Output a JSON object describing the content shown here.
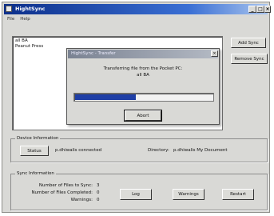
{
  "window": {
    "title": "HightSync",
    "controls": {
      "minimize": "_",
      "maximize": "□",
      "close": "×"
    }
  },
  "menu": [
    "File",
    "Help"
  ],
  "sync_list": [
    "all BA",
    "Peanut Press"
  ],
  "side_buttons": {
    "add": "Add Sync",
    "remove": "Remove Sync"
  },
  "dialog": {
    "title": "HightSync - Transfer",
    "close": "×",
    "message_line1": "Transferring file from the Pocket PC:",
    "message_line2": "all BA",
    "progress_fraction": 0.44,
    "abort": "Abort"
  },
  "device_info": {
    "group_label": "Device Information",
    "status_button": "Status",
    "status_text": "p.dhiwalis connected",
    "directory_label": "Directory:",
    "directory_value": "p.dhiwalis My Document"
  },
  "sync_info": {
    "group_label": "Sync Information",
    "files_to_sync_label": "Number of Files to Sync:",
    "files_to_sync_value": "3",
    "files_completed_label": "Number of Files Completed:",
    "files_completed_value": "0",
    "warnings_label": "Warnings:",
    "warnings_value": "0",
    "log_button": "Log",
    "warnings_button": "Warnings",
    "restart_button": "Restart"
  },
  "colors": {
    "title_active": "#0c2f8a",
    "progress_fill": "#1f3fa6",
    "face": "#d9d9d6"
  }
}
